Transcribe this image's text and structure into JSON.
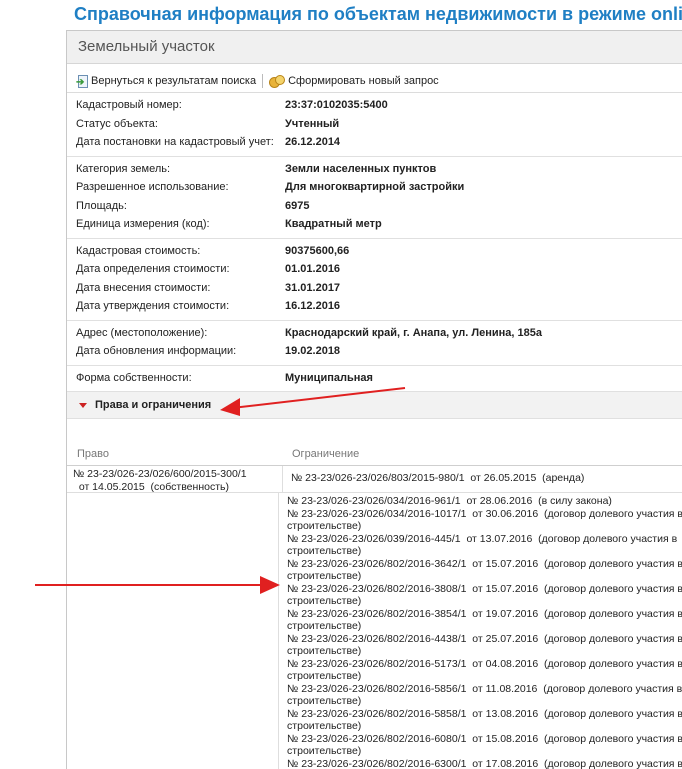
{
  "page": {
    "title": "Справочная информация по объектам недвижимости в режиме online"
  },
  "panel": {
    "header": "Земельный участок"
  },
  "toolbar": {
    "back_label": "Вернуться к результатам поиска",
    "new_query_label": "Сформировать новый запрос"
  },
  "sections": [
    {
      "rows": [
        {
          "label": "Кадастровый номер:",
          "value": "23:37:0102035:5400"
        },
        {
          "label": "Статус объекта:",
          "value": "Учтенный"
        },
        {
          "label": "Дата постановки на кадастровый учет:",
          "value": "26.12.2014"
        }
      ]
    },
    {
      "rows": [
        {
          "label": "Категория земель:",
          "value": "Земли населенных пунктов"
        },
        {
          "label": "Разрешенное использование:",
          "value": "Для многоквартирной застройки"
        },
        {
          "label": "Площадь:",
          "value": "6975"
        },
        {
          "label": "Единица измерения (код):",
          "value": "Квадратный метр"
        }
      ]
    },
    {
      "rows": [
        {
          "label": "Кадастровая стоимость:",
          "value": "90375600,66"
        },
        {
          "label": "Дата определения стоимости:",
          "value": "01.01.2016"
        },
        {
          "label": "Дата внесения стоимости:",
          "value": "31.01.2017"
        },
        {
          "label": "Дата утверждения стоимости:",
          "value": "16.12.2016"
        }
      ]
    },
    {
      "rows": [
        {
          "label": "Адрес (местоположение):",
          "value": "Краснодарский край, г. Анапа, ул. Ленина, 185а"
        },
        {
          "label": "Дата обновления информации:",
          "value": "19.02.2018"
        }
      ]
    },
    {
      "rows": [
        {
          "label": "Форма собственности:",
          "value": "Муниципальная"
        }
      ]
    }
  ],
  "rights": {
    "header": "Права и ограничения",
    "col_right": "Право",
    "col_limit": "Ограничение",
    "rows": [
      {
        "right": [
          "№ 23-23/026-23/026/600/2015-300/1",
          "  от 14.05.2015  (собственность)"
        ],
        "limits": [
          "№ 23-23/026-23/026/803/2015-980/1  от 26.05.2015  (аренда)"
        ]
      },
      {
        "right": [],
        "limits": [
          "№ 23-23/026-23/026/034/2016-961/1  от 28.06.2016  (в силу закона)",
          "№ 23-23/026-23/026/034/2016-1017/1  от 30.06.2016  (договор долевого участия в",
          "строительстве)",
          "№ 23-23/026-23/026/039/2016-445/1  от 13.07.2016  (договор долевого участия в",
          "строительстве)",
          "№ 23-23/026-23/026/802/2016-3642/1  от 15.07.2016  (договор долевого участия в",
          "строительстве)",
          "№ 23-23/026-23/026/802/2016-3808/1  от 15.07.2016  (договор долевого участия в",
          "строительстве)",
          "№ 23-23/026-23/026/802/2016-3854/1  от 19.07.2016  (договор долевого участия в",
          "строительстве)",
          "№ 23-23/026-23/026/802/2016-4438/1  от 25.07.2016  (договор долевого участия в",
          "строительстве)",
          "№ 23-23/026-23/026/802/2016-5173/1  от 04.08.2016  (договор долевого участия в",
          "строительстве)",
          "№ 23-23/026-23/026/802/2016-5856/1  от 11.08.2016  (договор долевого участия в",
          "строительстве)",
          "№ 23-23/026-23/026/802/2016-5858/1  от 13.08.2016  (договор долевого участия в",
          "строительстве)",
          "№ 23-23/026-23/026/802/2016-6080/1  от 15.08.2016  (договор долевого участия в",
          "строительстве)",
          "№ 23-23/026-23/026/802/2016-6300/1  от 17.08.2016  (договор долевого участия в"
        ]
      }
    ]
  },
  "colors": {
    "title": "#1f7fc4",
    "annotation_arrow": "#e02020"
  }
}
